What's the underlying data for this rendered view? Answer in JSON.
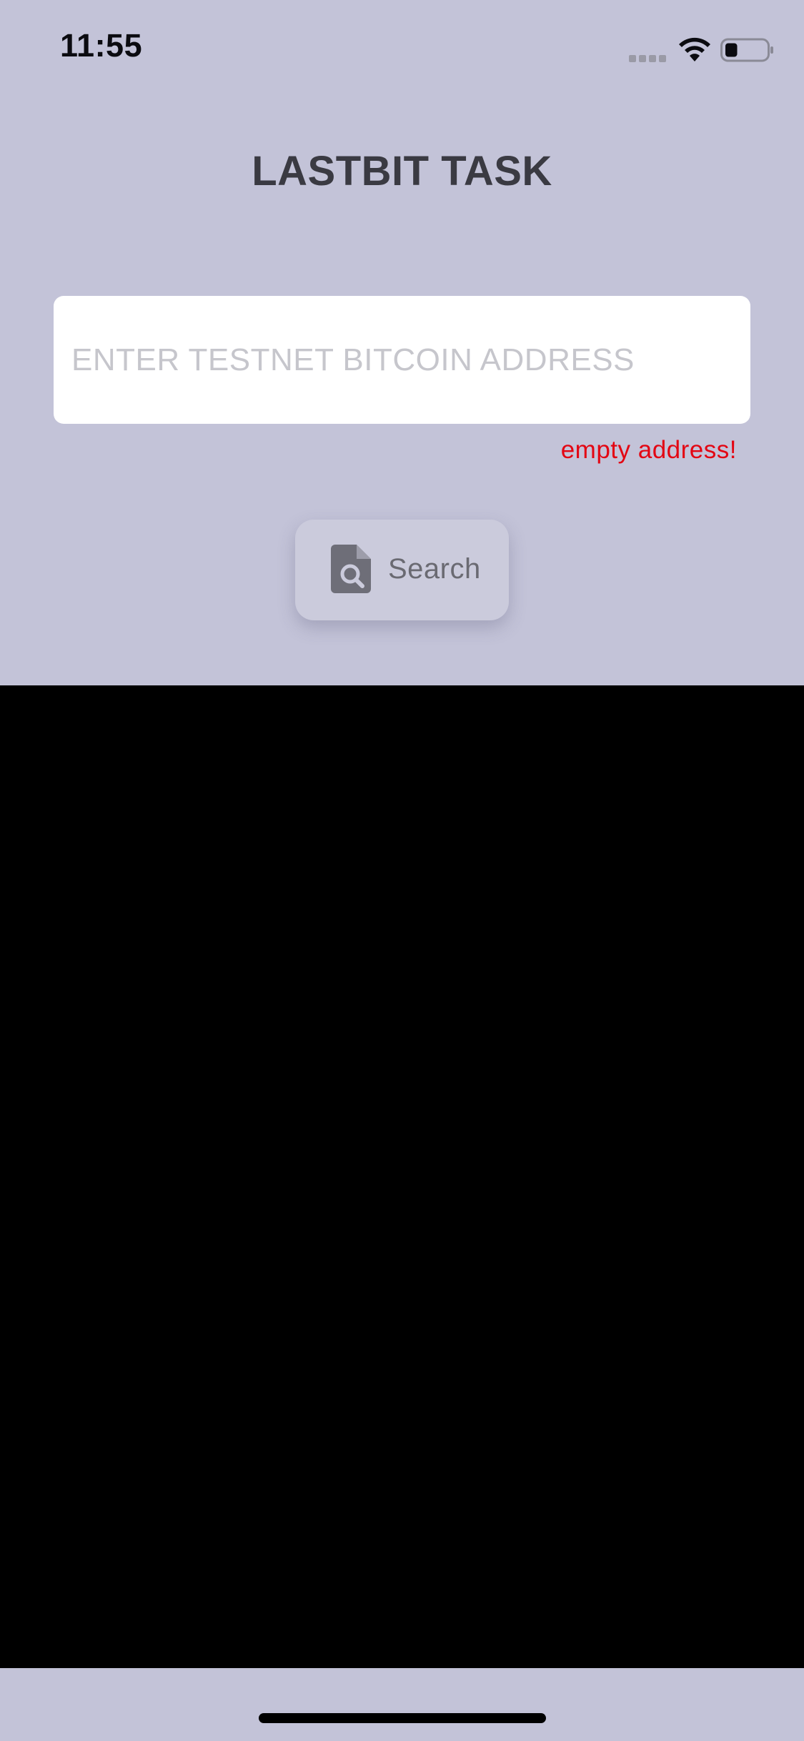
{
  "status_bar": {
    "time": "11:55",
    "icons": {
      "signal": "cellular-signal-icon",
      "wifi": "wifi-icon",
      "battery": "battery-icon"
    },
    "battery_level": 0.3
  },
  "header": {
    "title": "LASTBIT TASK"
  },
  "address_field": {
    "value": "",
    "placeholder": "ENTER TESTNET BITCOIN ADDRESS"
  },
  "error": {
    "message": "empty address!"
  },
  "search_button": {
    "label": "Search",
    "icon": "document-search-icon"
  },
  "colors": {
    "background": "#c3c3d8",
    "title": "#3a3a42",
    "error": "#e30613",
    "results_area": "#000000",
    "button": "#cbcbdc"
  }
}
